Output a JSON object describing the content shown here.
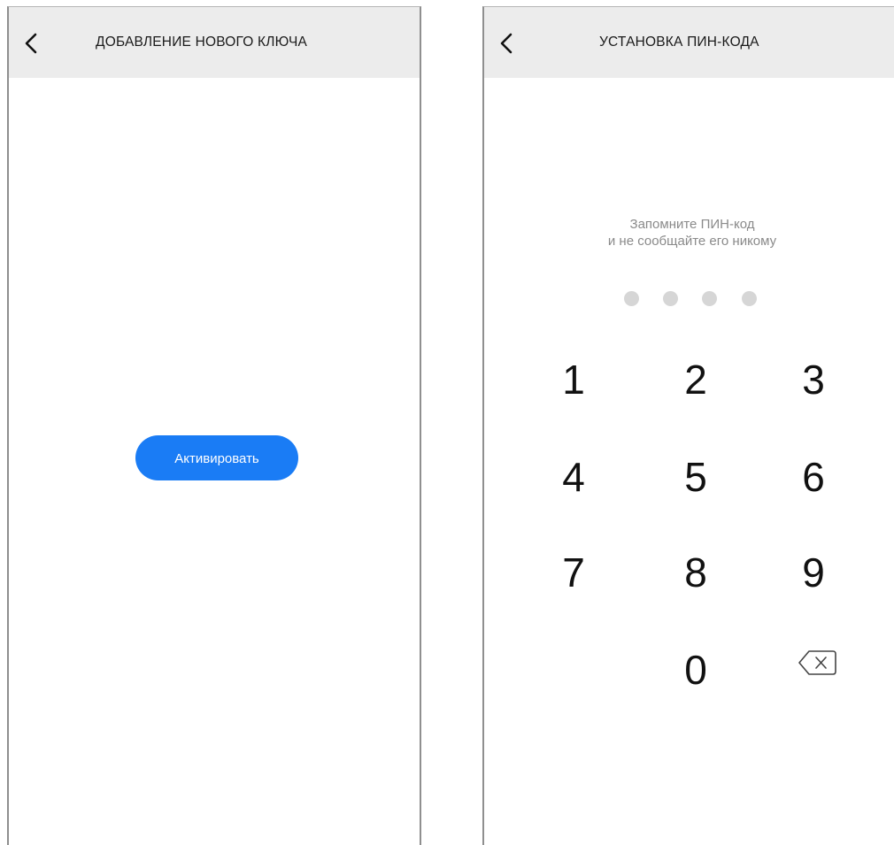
{
  "left_screen": {
    "title": "ДОБАВЛЕНИЕ НОВОГО КЛЮЧА",
    "back_icon": "chevron-left-icon",
    "activate_button_label": "Активировать",
    "accent_color": "#1a7cf5"
  },
  "right_screen": {
    "title": "УСТАНОВКА ПИН-КОДА",
    "back_icon": "chevron-left-icon",
    "hint_line1": "Запомните ПИН-код",
    "hint_line2": "и не сообщайте его никому",
    "pin_length": 4,
    "pin_filled": 0,
    "keypad": {
      "keys": [
        "1",
        "2",
        "3",
        "4",
        "5",
        "6",
        "7",
        "8",
        "9",
        "0"
      ],
      "backspace_icon": "backspace-icon"
    }
  }
}
